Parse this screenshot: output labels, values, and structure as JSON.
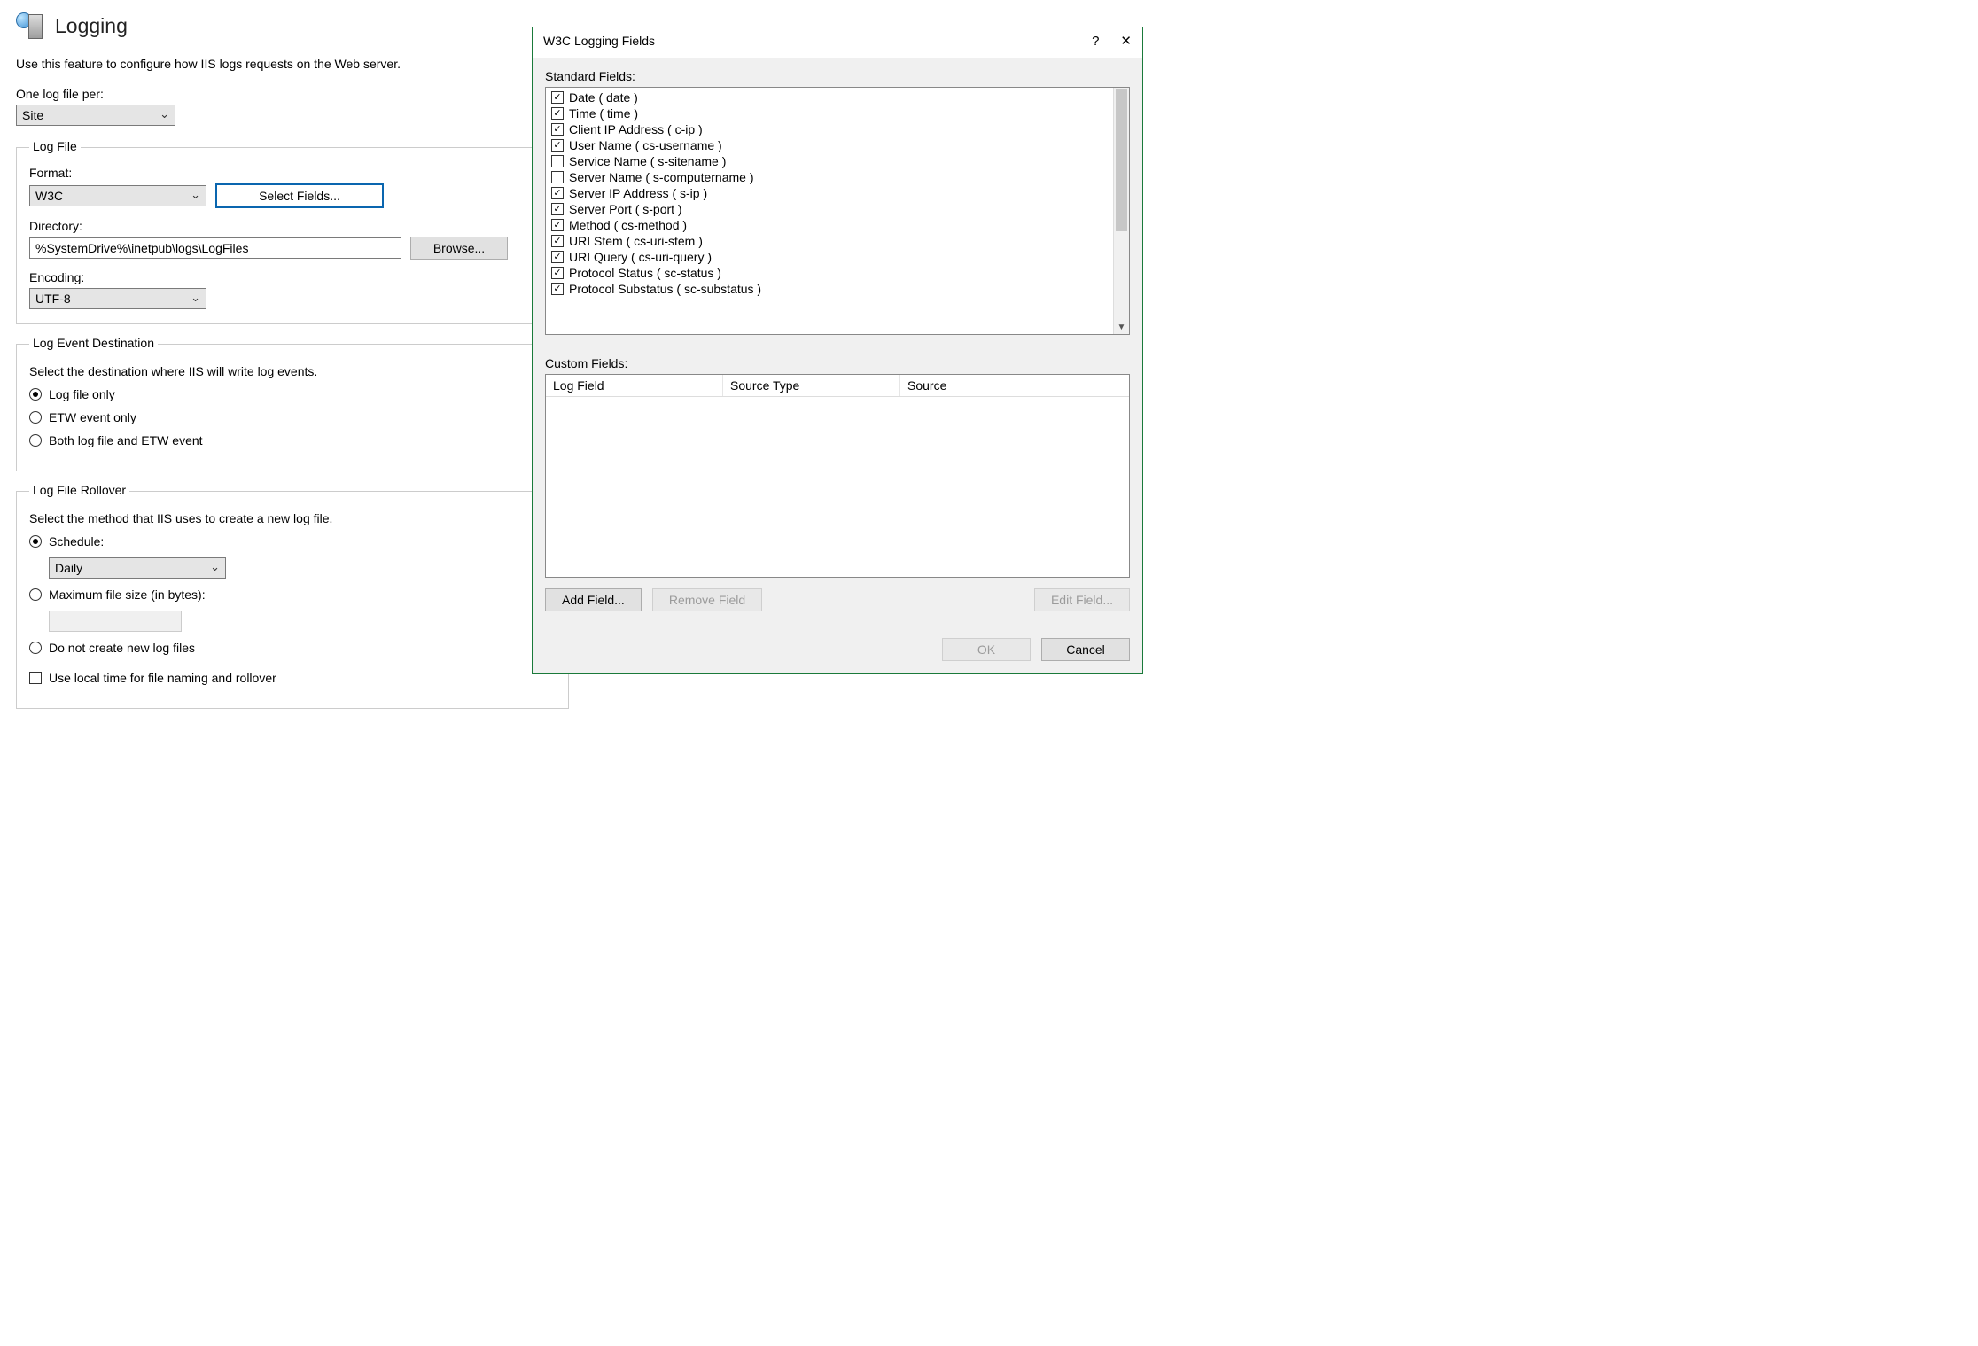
{
  "page": {
    "title": "Logging",
    "description": "Use this feature to configure how IIS logs requests on the Web server."
  },
  "one_log_file_per": {
    "label": "One log file per:",
    "value": "Site"
  },
  "log_file": {
    "legend": "Log File",
    "format_label": "Format:",
    "format_value": "W3C",
    "select_fields_label": "Select Fields...",
    "directory_label": "Directory:",
    "directory_value": "%SystemDrive%\\inetpub\\logs\\LogFiles",
    "browse_label": "Browse...",
    "encoding_label": "Encoding:",
    "encoding_value": "UTF-8"
  },
  "log_event_destination": {
    "legend": "Log Event Destination",
    "help": "Select the destination where IIS will write log events.",
    "options": [
      {
        "label": "Log file only",
        "selected": true
      },
      {
        "label": "ETW event only",
        "selected": false
      },
      {
        "label": "Both log file and ETW event",
        "selected": false
      }
    ]
  },
  "log_file_rollover": {
    "legend": "Log File Rollover",
    "help": "Select the method that IIS uses to create a new log file.",
    "schedule_label": "Schedule:",
    "schedule_value": "Daily",
    "schedule_selected": true,
    "max_size_label": "Maximum file size (in bytes):",
    "max_size_value": "",
    "nocreate_label": "Do not create new log files",
    "use_local_time_label": "Use local time for file naming and rollover"
  },
  "dialog": {
    "title": "W3C Logging Fields",
    "standard_fields_label": "Standard Fields:",
    "standard_fields": [
      {
        "label": "Date ( date )",
        "checked": true
      },
      {
        "label": "Time ( time )",
        "checked": true
      },
      {
        "label": "Client IP Address ( c-ip )",
        "checked": true
      },
      {
        "label": "User Name ( cs-username )",
        "checked": true
      },
      {
        "label": "Service Name ( s-sitename )",
        "checked": false
      },
      {
        "label": "Server Name ( s-computername )",
        "checked": false
      },
      {
        "label": "Server IP Address ( s-ip )",
        "checked": true
      },
      {
        "label": "Server Port ( s-port )",
        "checked": true
      },
      {
        "label": "Method ( cs-method )",
        "checked": true
      },
      {
        "label": "URI Stem ( cs-uri-stem )",
        "checked": true
      },
      {
        "label": "URI Query ( cs-uri-query )",
        "checked": true
      },
      {
        "label": "Protocol Status ( sc-status )",
        "checked": true
      },
      {
        "label": "Protocol Substatus ( sc-substatus )",
        "checked": true
      }
    ],
    "custom_fields_label": "Custom Fields:",
    "custom_columns": [
      "Log Field",
      "Source Type",
      "Source"
    ],
    "add_field_label": "Add Field...",
    "remove_field_label": "Remove Field",
    "edit_field_label": "Edit Field...",
    "ok_label": "OK",
    "cancel_label": "Cancel"
  }
}
